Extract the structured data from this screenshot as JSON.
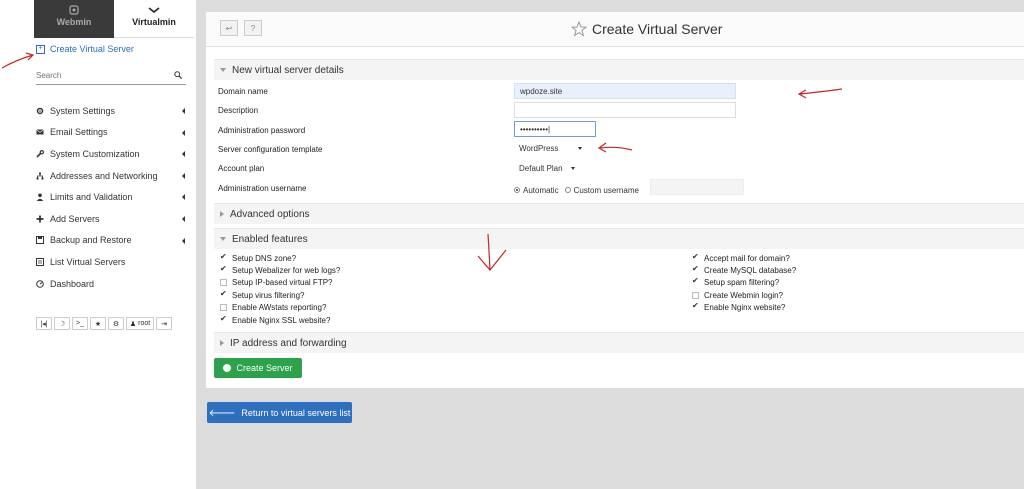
{
  "sidebar": {
    "tabs": [
      {
        "label": "Webmin",
        "icon": "webmin-logo-icon"
      },
      {
        "label": "Virtualmin",
        "icon": "virtualmin-logo-icon"
      }
    ],
    "create_link": "Create Virtual Server",
    "search_placeholder": "Search",
    "items": [
      {
        "label": "System Settings",
        "icon": "gear-icon"
      },
      {
        "label": "Email Settings",
        "icon": "envelope-icon"
      },
      {
        "label": "System Customization",
        "icon": "wrench-icon"
      },
      {
        "label": "Addresses and Networking",
        "icon": "network-icon"
      },
      {
        "label": "Limits and Validation",
        "icon": "user-icon"
      },
      {
        "label": "Add Servers",
        "icon": "plus-icon"
      },
      {
        "label": "Backup and Restore",
        "icon": "save-icon"
      },
      {
        "label": "List Virtual Servers",
        "icon": "list-icon"
      },
      {
        "label": "Dashboard",
        "icon": "dashboard-icon"
      }
    ],
    "toolbar": {
      "b1": "|◂|",
      "b2": "☽",
      "b3": ">_",
      "b4": "★",
      "b5": "⚙",
      "user": "root",
      "b7": "⇥"
    }
  },
  "header": {
    "back": "↩",
    "help": "?",
    "title": "Create Virtual Server"
  },
  "form": {
    "section_details": "New virtual server details",
    "domain_label": "Domain name",
    "domain_value": "wpdoze.site",
    "description_label": "Description",
    "password_label": "Administration password",
    "password_value": "••••••••••|",
    "template_label": "Server configuration template",
    "template_value": "WordPress",
    "plan_label": "Account plan",
    "plan_value": "Default Plan",
    "username_label": "Administration username",
    "radio_automatic": "Automatic",
    "radio_custom": "Custom username",
    "section_advanced": "Advanced options",
    "section_features": "Enabled features",
    "section_ip": "IP address and forwarding"
  },
  "features_left": [
    {
      "label": "Setup DNS zone?",
      "checked": true
    },
    {
      "label": "Setup Webalizer for web logs?",
      "checked": true
    },
    {
      "label": "Setup IP-based virtual FTP?",
      "checked": false
    },
    {
      "label": "Setup virus filtering?",
      "checked": true
    },
    {
      "label": "Enable AWstats reporting?",
      "checked": false
    },
    {
      "label": "Enable Nginx SSL website?",
      "checked": true
    }
  ],
  "features_right": [
    {
      "label": "Accept mail for domain?",
      "checked": true
    },
    {
      "label": "Create MySQL database?",
      "checked": true
    },
    {
      "label": "Setup spam filtering?",
      "checked": true
    },
    {
      "label": "Create Webmin login?",
      "checked": false
    },
    {
      "label": "Enable Nginx website?",
      "checked": true
    }
  ],
  "buttons": {
    "create": "Create Server",
    "return": "Return to virtual servers list"
  },
  "colors": {
    "accent_green": "#2ba24c",
    "accent_blue": "#2f6fc0",
    "annotation_red": "#c0282a"
  }
}
